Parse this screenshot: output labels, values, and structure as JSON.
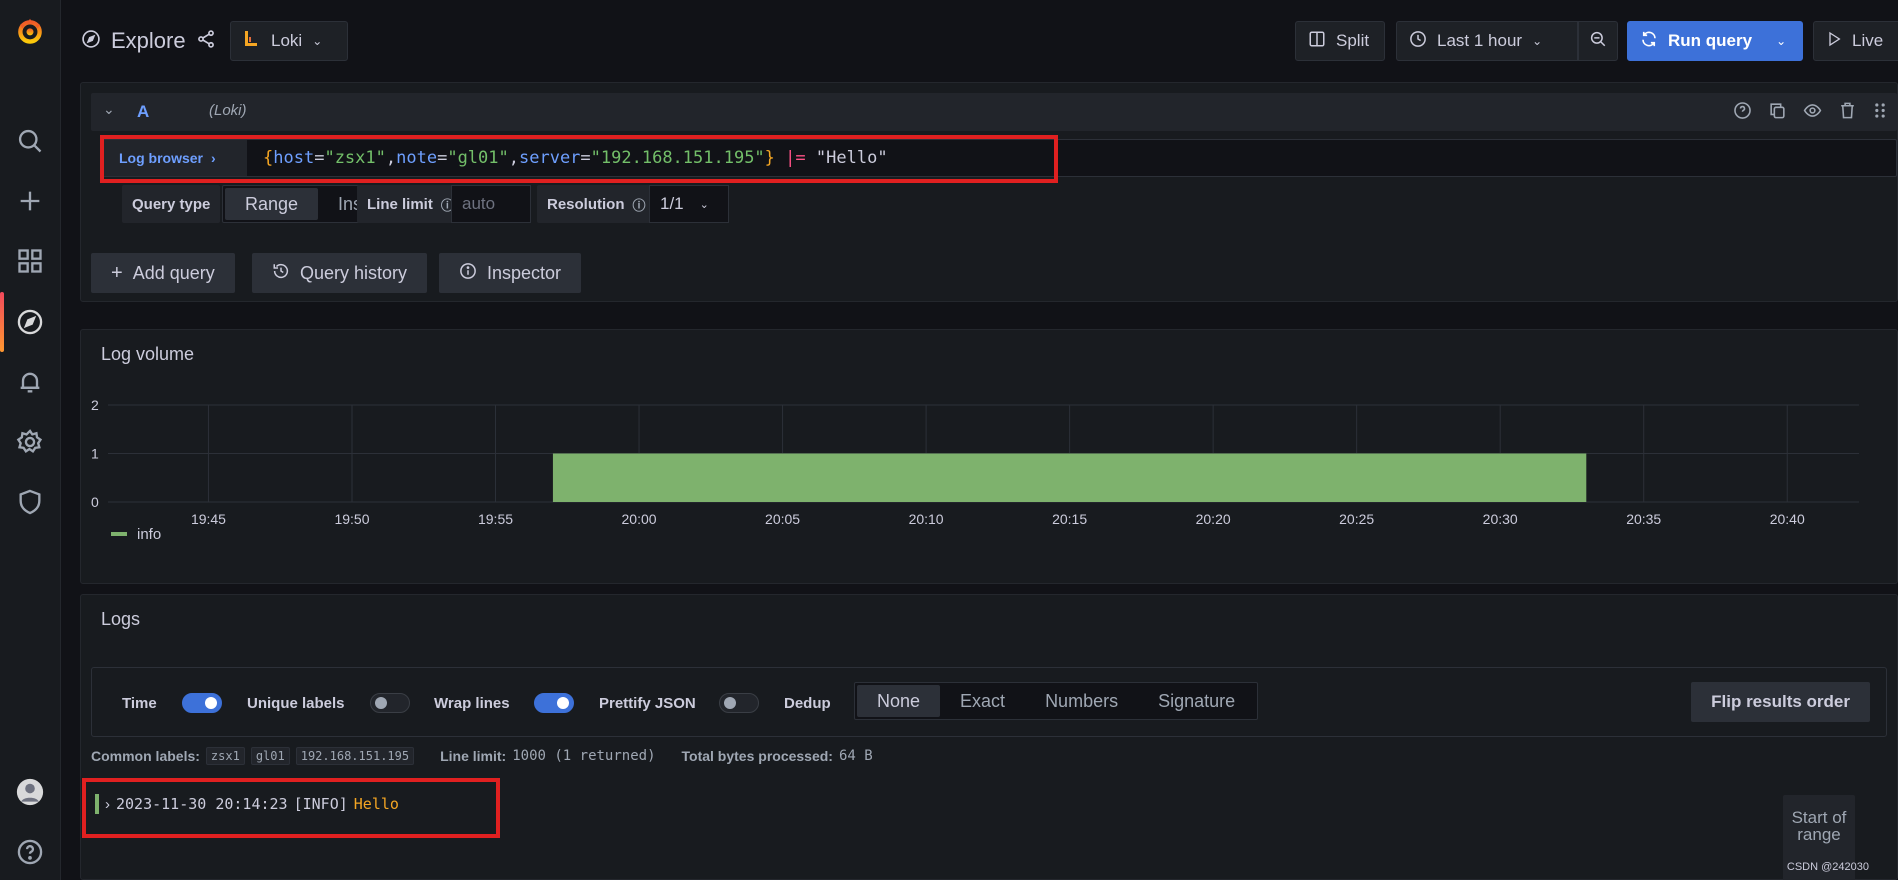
{
  "app": {
    "page_title": "Explore",
    "datasource": "Loki"
  },
  "toolbar": {
    "split_label": "Split",
    "time_range": "Last 1 hour",
    "run_query_label": "Run query",
    "live_label": "Live"
  },
  "query": {
    "ref_id": "A",
    "datasource_hint": "(Loki)",
    "log_browser_label": "Log browser",
    "expr_parts": {
      "brace_open": "{",
      "k1": "host",
      "v1": "\"zsx1\"",
      "k2": "note",
      "v2": "\"gl01\"",
      "k3": "server",
      "v3": "\"192.168.151.195\"",
      "brace_close": "}",
      "op": "|=",
      "filter": "\"Hello\""
    },
    "query_type_label": "Query type",
    "query_type_options": [
      "Range",
      "Instant"
    ],
    "query_type_selected": "Range",
    "line_limit_label": "Line limit",
    "line_limit_placeholder": "auto",
    "resolution_label": "Resolution",
    "resolution_value": "1/1"
  },
  "actions": {
    "add_query": "Add query",
    "query_history": "Query history",
    "inspector": "Inspector"
  },
  "chart_data": {
    "type": "bar",
    "title": "Log volume",
    "x_ticks": [
      "19:45",
      "19:50",
      "19:55",
      "20:00",
      "20:05",
      "20:10",
      "20:15",
      "20:20",
      "20:25",
      "20:30",
      "20:35",
      "20:40"
    ],
    "y_ticks": [
      "0",
      "1",
      "2"
    ],
    "ylim": [
      0,
      2
    ],
    "series": [
      {
        "name": "info",
        "color": "#7eb26d",
        "x_start": "19:57",
        "x_end": "20:33",
        "value": 1
      }
    ],
    "legend_position": "bottom-left",
    "grid": true
  },
  "logs": {
    "title": "Logs",
    "time_label": "Time",
    "time_on": true,
    "unique_labels_label": "Unique labels",
    "unique_labels_on": false,
    "wrap_lines_label": "Wrap lines",
    "wrap_lines_on": true,
    "prettify_json_label": "Prettify JSON",
    "prettify_json_on": false,
    "dedup_label": "Dedup",
    "dedup_options": [
      "None",
      "Exact",
      "Numbers",
      "Signature"
    ],
    "dedup_selected": "None",
    "flip_label": "Flip results order",
    "common_labels_label": "Common labels:",
    "common_labels": [
      "zsx1",
      "gl01",
      "192.168.151.195"
    ],
    "line_limit_text": "Line limit:",
    "line_limit_value": "1000 (1 returned)",
    "bytes_label": "Total bytes processed:",
    "bytes_value": "64 B",
    "rows": [
      {
        "timestamp": "2023-11-30 20:14:23",
        "level_tag": "[INFO]",
        "message": "Hello"
      }
    ],
    "start_of_range": "Start of range"
  },
  "watermark": "CSDN @242030"
}
